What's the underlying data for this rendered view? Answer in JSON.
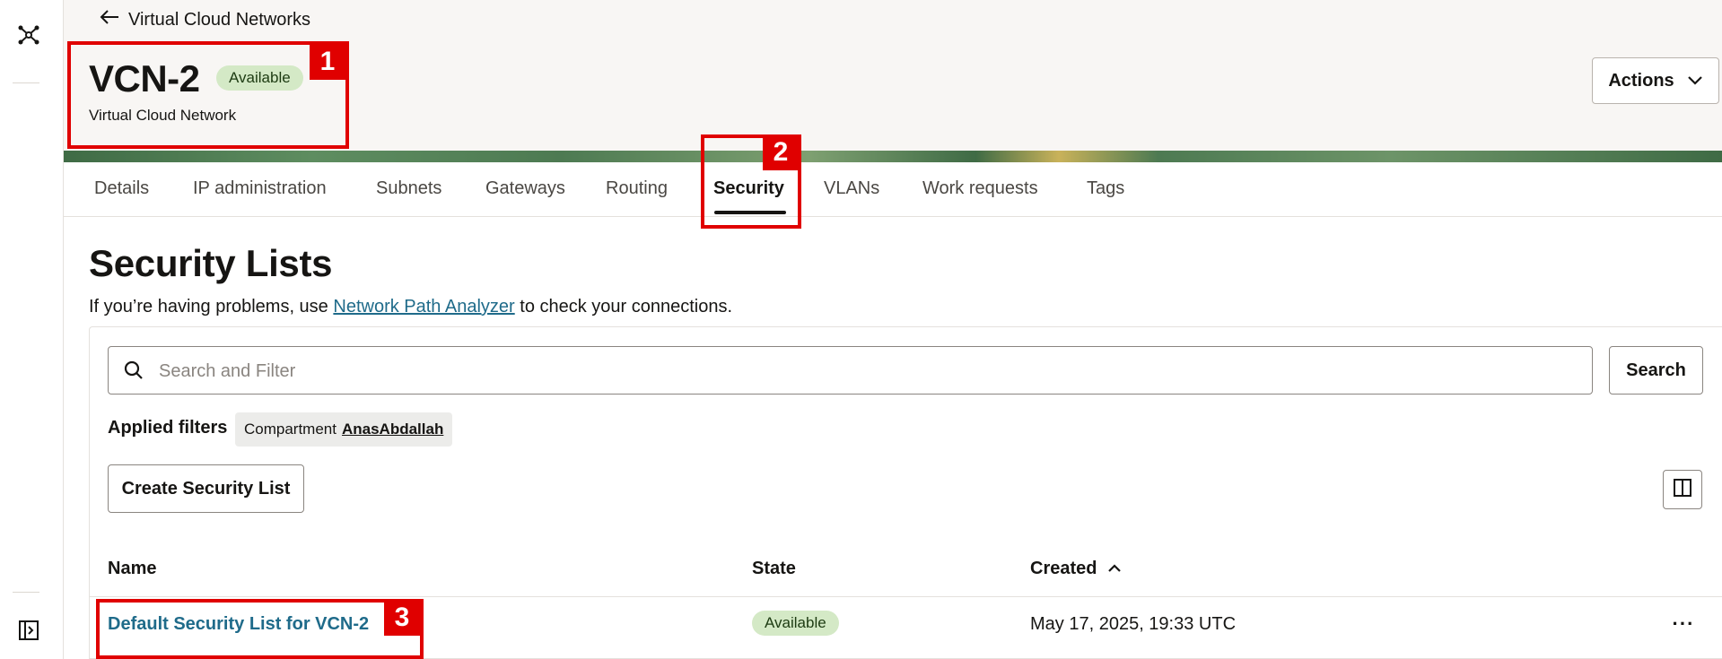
{
  "nav": {
    "back_label": "Virtual Cloud Networks"
  },
  "header": {
    "title": "VCN-2",
    "status": "Available",
    "subtitle": "Virtual Cloud Network",
    "actions_label": "Actions"
  },
  "tabs": [
    {
      "label": "Details"
    },
    {
      "label": "IP administration"
    },
    {
      "label": "Subnets"
    },
    {
      "label": "Gateways"
    },
    {
      "label": "Routing"
    },
    {
      "label": "Security",
      "active": true
    },
    {
      "label": "VLANs"
    },
    {
      "label": "Work requests"
    },
    {
      "label": "Tags"
    }
  ],
  "section": {
    "title": "Security Lists",
    "help_prefix": "If you’re having problems, use ",
    "help_link": "Network Path Analyzer",
    "help_suffix": " to check your connections."
  },
  "search": {
    "placeholder": "Search and Filter",
    "button_label": "Search"
  },
  "filters": {
    "label": "Applied filters",
    "chip_key": "Compartment",
    "chip_value": "AnasAbdallah"
  },
  "create_button": "Create Security List",
  "table": {
    "columns": [
      "Name",
      "State",
      "Created"
    ],
    "sort_column": "Created",
    "rows": [
      {
        "name": "Default Security List for VCN-2",
        "state": "Available",
        "created": "May 17, 2025, 19:33 UTC"
      }
    ]
  },
  "annotations": [
    "1",
    "2",
    "3"
  ],
  "colors": {
    "accent": "#1f6b8a",
    "annotation_red": "#e00000",
    "status_bg": "#d4e9c6",
    "header_bg": "#f8f6f4"
  },
  "icons": [
    "network-icon",
    "expand-panel-icon",
    "arrow-left-icon",
    "chevron-down-icon",
    "search-icon",
    "columns-icon",
    "sort-ascending-icon",
    "more-icon"
  ]
}
